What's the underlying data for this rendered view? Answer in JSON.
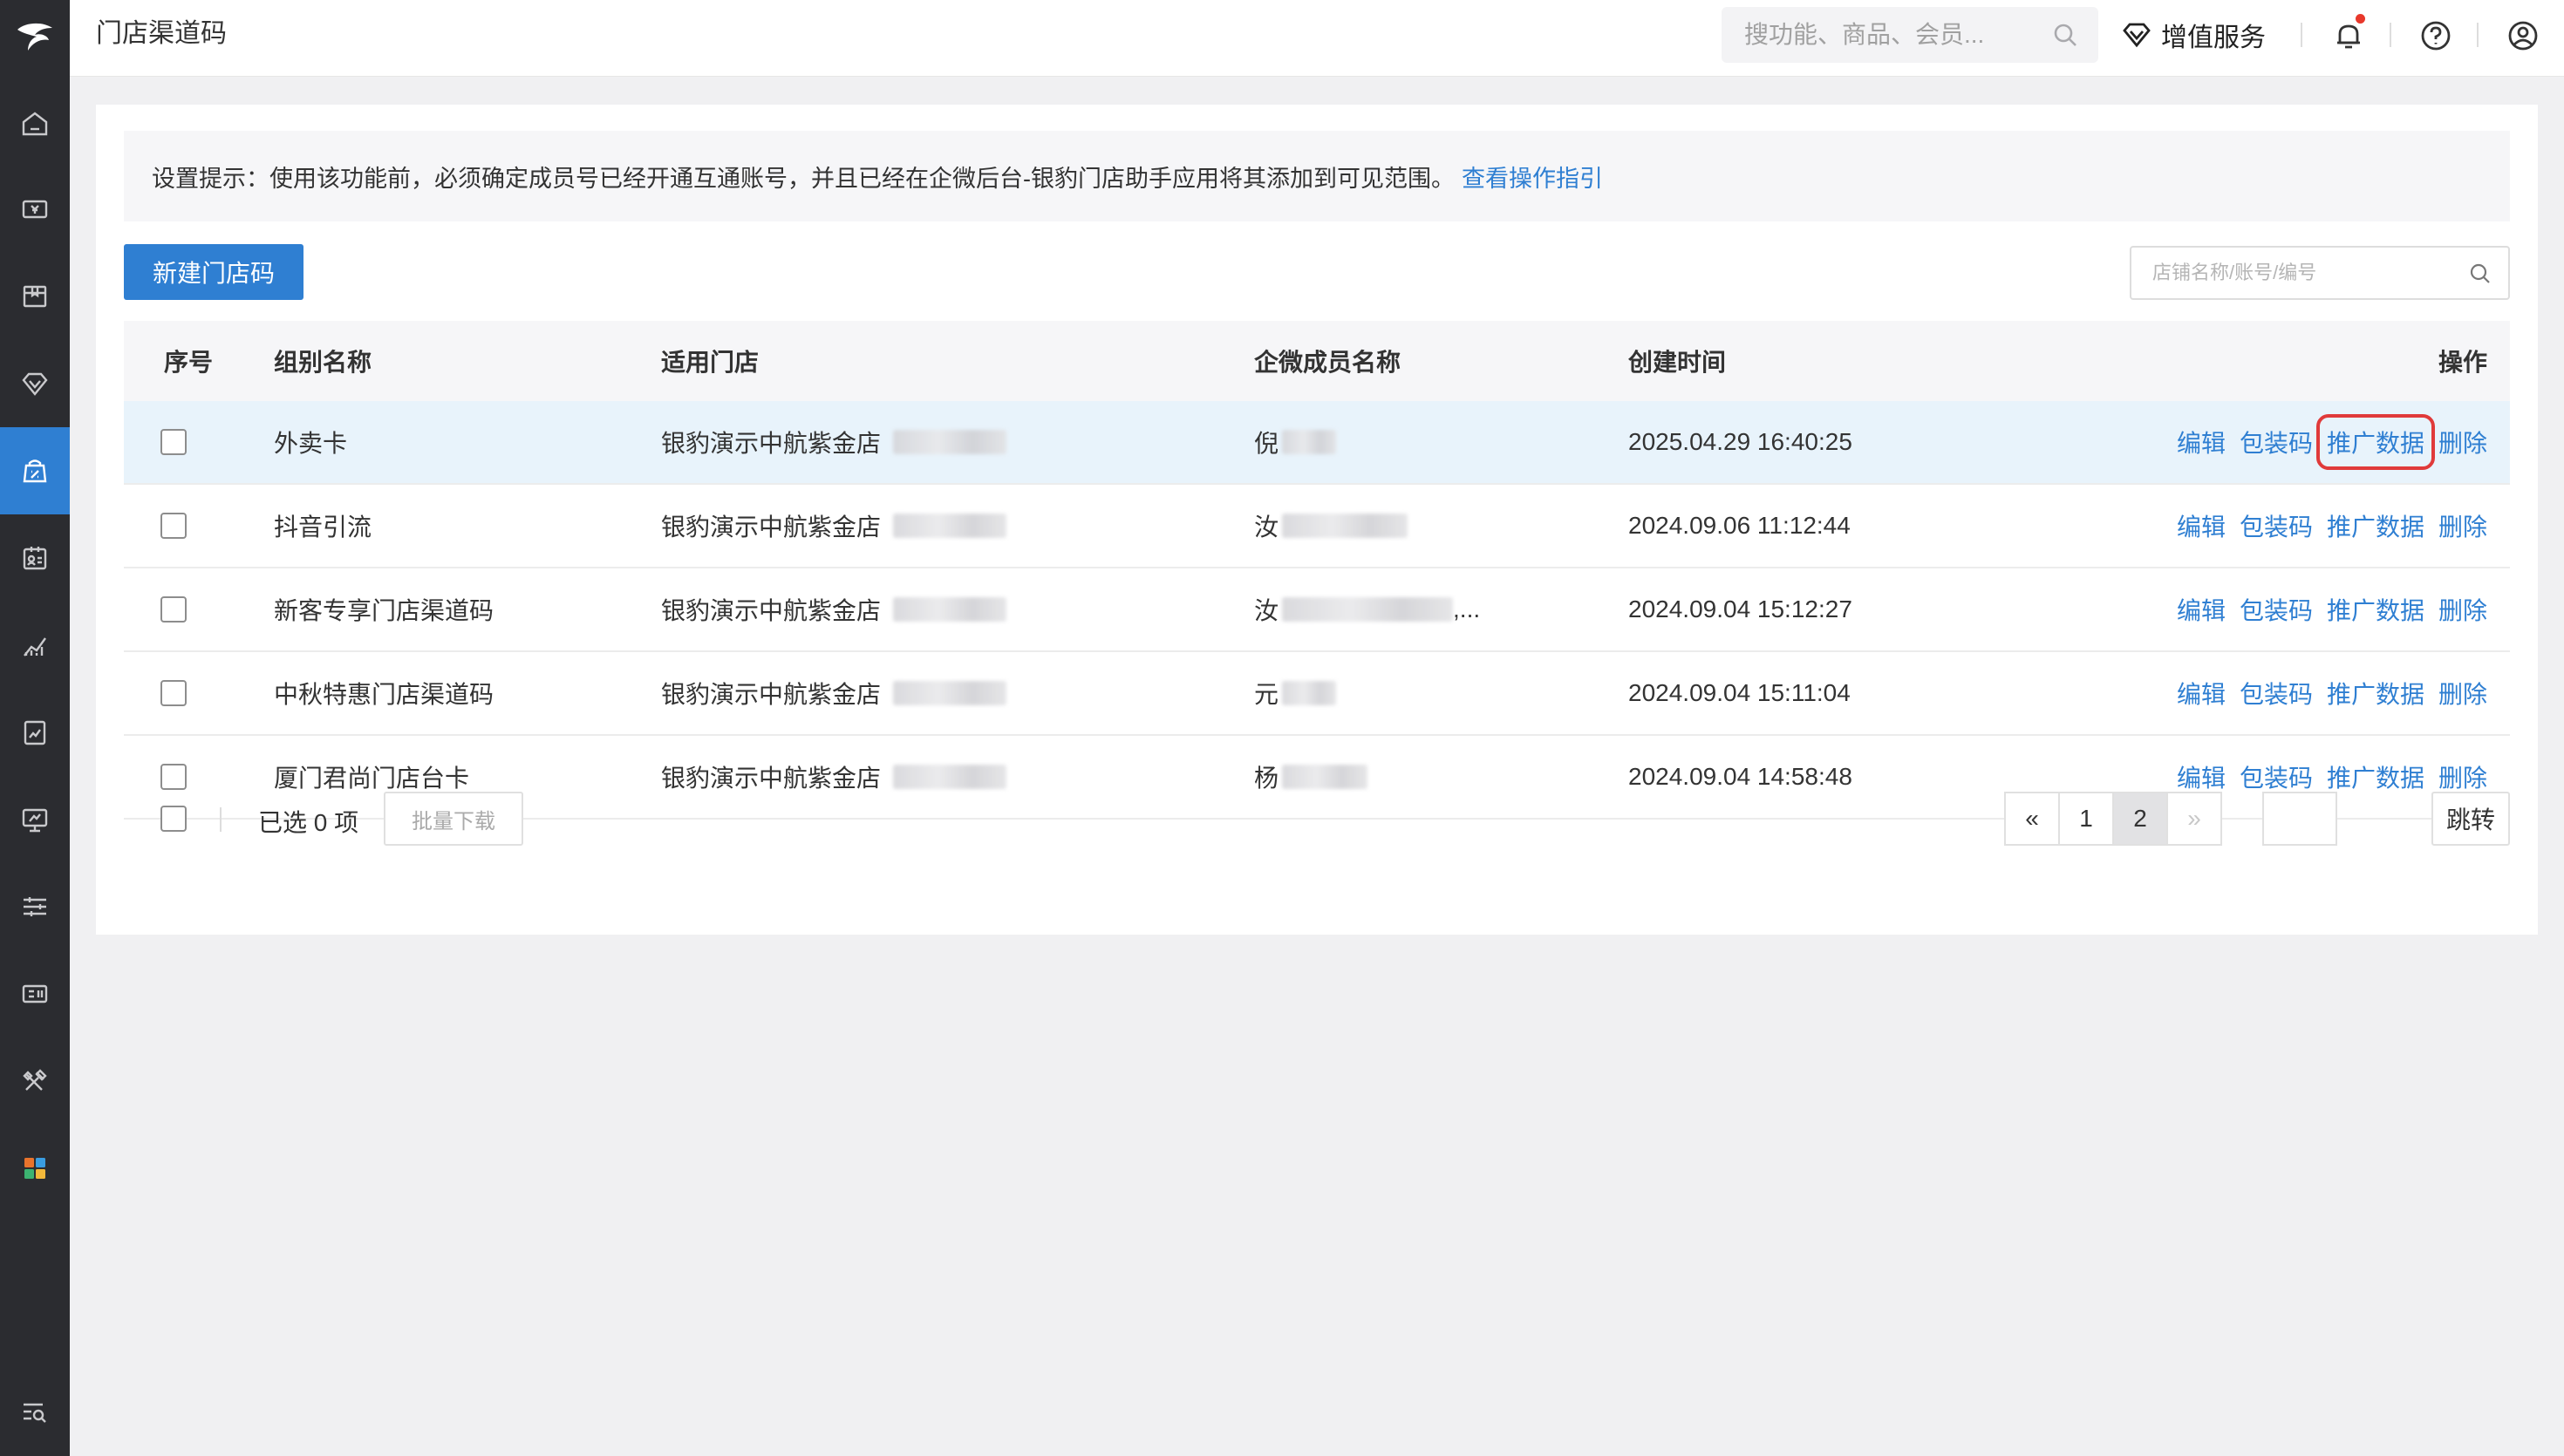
{
  "header": {
    "title": "门店渠道码",
    "search_placeholder": "搜功能、商品、会员...",
    "vas_label": "增值服务"
  },
  "sidebar": {
    "items": [
      {
        "icon": "home-icon"
      },
      {
        "icon": "cashier-icon"
      },
      {
        "icon": "product-box-icon"
      },
      {
        "icon": "member-diamond-icon"
      },
      {
        "icon": "marketing-icon",
        "active": true
      },
      {
        "icon": "employee-card-icon"
      },
      {
        "icon": "analytics-chart-icon"
      },
      {
        "icon": "report-icon"
      },
      {
        "icon": "monitor-icon"
      },
      {
        "icon": "settings-sliders-icon"
      },
      {
        "icon": "device-icon"
      },
      {
        "icon": "tools-icon"
      },
      {
        "icon": "apps-grid-icon"
      },
      {
        "icon": "search-menu-icon"
      }
    ]
  },
  "tip": {
    "text": "设置提示：使用该功能前，必须确定成员号已经开通互通账号，并且已经在企微后台-银豹门店助手应用将其添加到可见范围。",
    "link": "查看操作指引"
  },
  "toolbar": {
    "new_button": "新建门店码",
    "filter_placeholder": "店铺名称/账号/编号"
  },
  "table": {
    "headers": {
      "index": "序号",
      "group": "组别名称",
      "store": "适用门店",
      "member": "企微成员名称",
      "created": "创建时间",
      "ops": "操作"
    },
    "rows": [
      {
        "group": "外卖卡",
        "store": "银豹演示中航紫金店",
        "member": "倪",
        "created": "2025.04.29 16:40:25"
      },
      {
        "group": "抖音引流",
        "store": "银豹演示中航紫金店",
        "member": "汝",
        "created": "2024.09.06 11:12:44"
      },
      {
        "group": "新客专享门店渠道码",
        "store": "银豹演示中航紫金店",
        "member": "汝",
        "member_suffix": ",...",
        "created": "2024.09.04 15:12:27"
      },
      {
        "group": "中秋特惠门店渠道码",
        "store": "银豹演示中航紫金店",
        "member": "元",
        "created": "2024.09.04 15:11:04"
      },
      {
        "group": "厦门君尚门店台卡",
        "store": "银豹演示中航紫金店",
        "member": "杨",
        "created": "2024.09.04 14:58:48"
      }
    ],
    "ops": {
      "edit": "编辑",
      "package": "包装码",
      "promo": "推广数据",
      "delete": "删除"
    }
  },
  "footer": {
    "selected": "已选 0 项",
    "batch_download": "批量下载",
    "pager": {
      "prev": "«",
      "pages": [
        "1",
        "2"
      ],
      "current": "2",
      "next": "»",
      "jump": "跳转"
    }
  },
  "colors": {
    "brand": "#2f7fd2",
    "sidebar": "#2b2c30",
    "highlight_row": "#e8f3fb",
    "red_marker": "#e03a3a"
  }
}
